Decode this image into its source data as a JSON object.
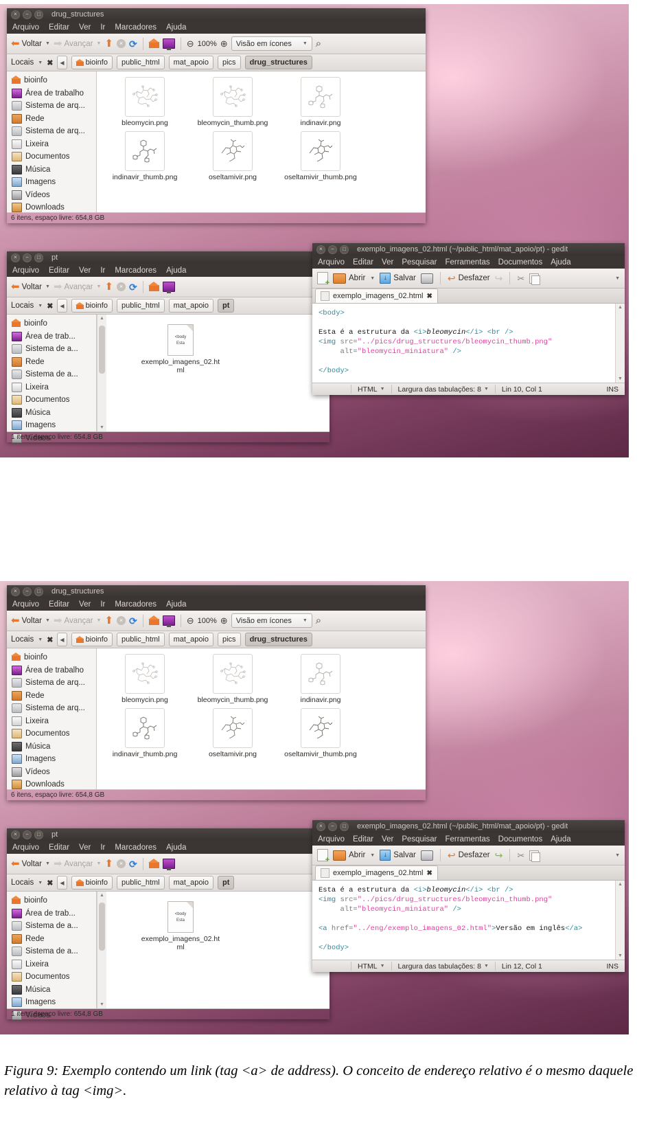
{
  "figure": {
    "caption": "Figura 9: Exemplo contendo um link (tag <a> de address). O conceito de endereço relativo é o mesmo daquele relativo à tag <img>."
  },
  "colors": {
    "accent_orange": "#e8762c",
    "titlebar_dark": "#3b3634",
    "string_pink": "#e23fa0",
    "tag_teal": "#2e8b9b"
  },
  "file_manager": {
    "title": "drug_structures",
    "menu": [
      "Arquivo",
      "Editar",
      "Ver",
      "Ir",
      "Marcadores",
      "Ajuda"
    ],
    "toolbar": {
      "back": "Voltar",
      "forward": "Avançar",
      "zoom_level": "100%",
      "view_mode": "Visão em ícones"
    },
    "location": {
      "label": "Locais",
      "breadcrumbs": [
        "bioinfo",
        "public_html",
        "mat_apoio",
        "pics",
        "drug_structures"
      ],
      "current": "drug_structures"
    },
    "sidebar": [
      {
        "label": "bioinfo",
        "icon": "home-icon"
      },
      {
        "label": "Área de trabalho",
        "icon": "desktop-icon"
      },
      {
        "label": "Sistema de arq...",
        "icon": "disk-icon"
      },
      {
        "label": "Rede",
        "icon": "network-icon"
      },
      {
        "label": "Sistema de arq...",
        "icon": "disk-icon"
      },
      {
        "label": "Lixeira",
        "icon": "trash-icon"
      },
      {
        "label": "Documentos",
        "icon": "documents-icon"
      },
      {
        "label": "Música",
        "icon": "music-icon"
      },
      {
        "label": "Imagens",
        "icon": "pictures-icon"
      },
      {
        "label": "Vídeos",
        "icon": "videos-icon"
      },
      {
        "label": "Downloads",
        "icon": "downloads-icon"
      }
    ],
    "files": [
      {
        "name": "bleomycin.png"
      },
      {
        "name": "bleomycin_thumb.png"
      },
      {
        "name": "indinavir.png"
      },
      {
        "name": "indinavir_thumb.png"
      },
      {
        "name": "oseltamivir.png"
      },
      {
        "name": "oseltamivir_thumb.png"
      }
    ],
    "status": "6 itens, espaço livre: 654,8 GB"
  },
  "file_manager_pt": {
    "title": "pt",
    "menu": [
      "Arquivo",
      "Editar",
      "Ver",
      "Ir",
      "Marcadores",
      "Ajuda"
    ],
    "toolbar": {
      "back": "Voltar",
      "forward": "Avançar"
    },
    "location": {
      "label": "Locais",
      "breadcrumbs": [
        "bioinfo",
        "public_html",
        "mat_apoio",
        "pt"
      ],
      "current": "pt"
    },
    "sidebar": [
      {
        "label": "bioinfo",
        "icon": "home-icon"
      },
      {
        "label": "Área de trab...",
        "icon": "desktop-icon"
      },
      {
        "label": "Sistema de a...",
        "icon": "disk-icon"
      },
      {
        "label": "Rede",
        "icon": "network-icon"
      },
      {
        "label": "Sistema de a...",
        "icon": "disk-icon"
      },
      {
        "label": "Lixeira",
        "icon": "trash-icon"
      },
      {
        "label": "Documentos",
        "icon": "documents-icon"
      },
      {
        "label": "Música",
        "icon": "music-icon"
      },
      {
        "label": "Imagens",
        "icon": "pictures-icon"
      },
      {
        "label": "Vídeos",
        "icon": "videos-icon"
      }
    ],
    "files": [
      {
        "name": "exemplo_imagens_02.html",
        "preview_lines": [
          "<body",
          "Esta"
        ]
      }
    ],
    "status": "1 item, espaço livre: 654,8 GB"
  },
  "gedit_top": {
    "title": "exemplo_imagens_02.html (~/public_html/mat_apoio/pt) - gedit",
    "menu": [
      "Arquivo",
      "Editar",
      "Ver",
      "Pesquisar",
      "Ferramentas",
      "Documentos",
      "Ajuda"
    ],
    "toolbar": {
      "open": "Abrir",
      "save": "Salvar",
      "undo": "Desfazer"
    },
    "tab": "exemplo_imagens_02.html",
    "code_lines": [
      "<body>",
      "",
      "Esta é a estrutura da <i>bleomycin</i> <br />",
      "<img src=\"../pics/drug_structures/bleomycin_thumb.png\"",
      "     alt=\"bleomycin_miniatura\" />",
      "",
      "</body>"
    ],
    "status": {
      "language": "HTML",
      "tab_width": "Largura das tabulações: 8",
      "position": "Lin 10, Col 1",
      "mode": "INS"
    }
  },
  "gedit_bottom": {
    "title": "exemplo_imagens_02.html (~/public_html/mat_apoio/pt) - gedit",
    "menu": [
      "Arquivo",
      "Editar",
      "Ver",
      "Pesquisar",
      "Ferramentas",
      "Documentos",
      "Ajuda"
    ],
    "toolbar": {
      "open": "Abrir",
      "save": "Salvar",
      "undo": "Desfazer"
    },
    "tab": "exemplo_imagens_02.html",
    "code_lines": [
      "Esta é a estrutura da <i>bleomycin</i> <br />",
      "<img src=\"../pics/drug_structures/bleomycin_thumb.png\"",
      "     alt=\"bleomycin_miniatura\" />",
      "",
      "<a href=\"../eng/exemplo_imagens_02.html\">Versão em inglês</a>",
      "",
      "</body>"
    ],
    "status": {
      "language": "HTML",
      "tab_width": "Largura das tabulações: 8",
      "position": "Lin 12, Col 1",
      "mode": "INS"
    }
  }
}
